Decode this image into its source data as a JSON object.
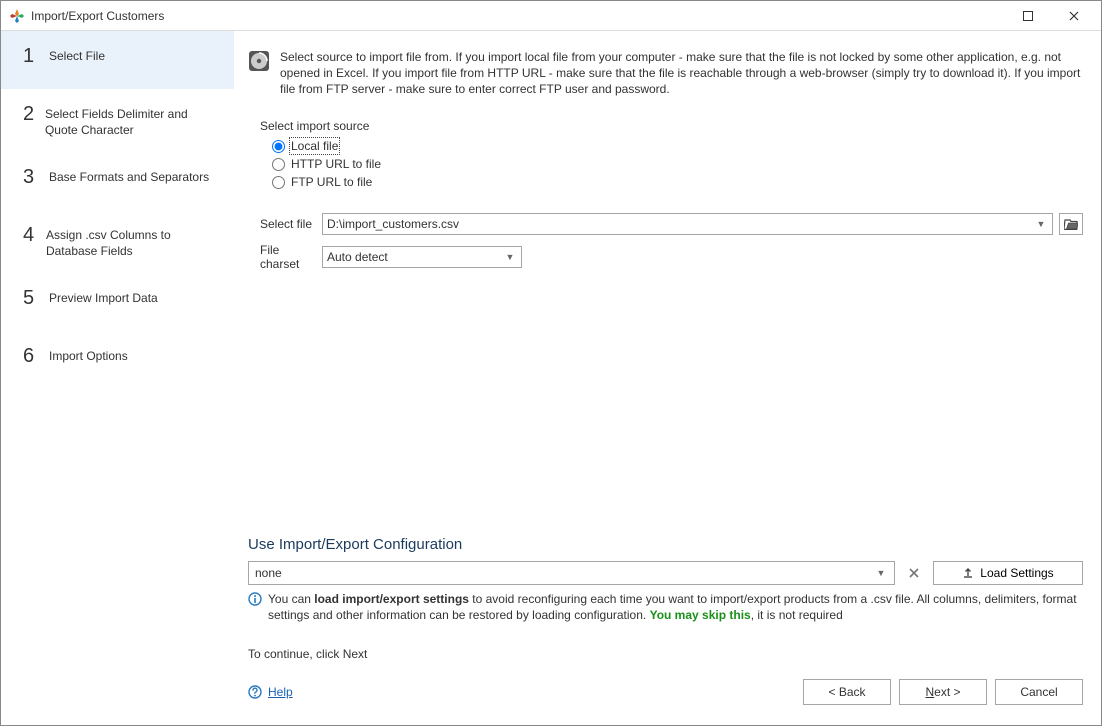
{
  "window": {
    "title": "Import/Export Customers"
  },
  "sidebar": {
    "steps": [
      {
        "num": "1",
        "label": "Select File"
      },
      {
        "num": "2",
        "label": "Select Fields Delimiter and Quote Character"
      },
      {
        "num": "3",
        "label": "Base Formats and Separators"
      },
      {
        "num": "4",
        "label": "Assign .csv Columns to Database Fields"
      },
      {
        "num": "5",
        "label": "Preview Import Data"
      },
      {
        "num": "6",
        "label": "Import Options"
      }
    ]
  },
  "intro": {
    "text": "Select source to import file from. If you import local file from your computer - make sure that the file is not locked by some other application, e.g. not opened in Excel. If you import file from HTTP URL - make sure that the file is reachable through a web-browser (simply try to download it). If you import file from FTP server - make sure to enter correct FTP user and password."
  },
  "source": {
    "label": "Select import source",
    "options": {
      "local": "Local file",
      "http": "HTTP URL to file",
      "ftp": "FTP URL to file"
    },
    "selected": "local"
  },
  "file": {
    "label": "Select file",
    "value": "D:\\import_customers.csv"
  },
  "charset": {
    "label": "File charset",
    "value": "Auto detect"
  },
  "config": {
    "title": "Use Import/Export Configuration",
    "value": "none",
    "load_label": "Load Settings",
    "note_pre": "You can ",
    "note_bold": "load import/export settings",
    "note_mid": " to avoid reconfiguring each time you want to import/export products from a .csv file. All columns, delimiters, format settings and other information can be restored by loading configuration. ",
    "note_green": "You may skip this",
    "note_end": ", it is not required"
  },
  "continue": "To continue, click Next",
  "footer": {
    "help": "Help",
    "back": "< Back",
    "next_pre": "N",
    "next_post": "ext >",
    "cancel": "Cancel"
  }
}
